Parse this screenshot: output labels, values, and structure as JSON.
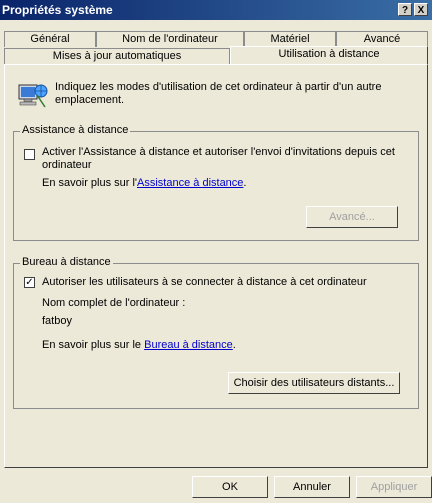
{
  "window": {
    "title": "Propriétés système",
    "help_label": "?",
    "close_label": "X"
  },
  "tabs_back": [
    {
      "label": "Général"
    },
    {
      "label": "Nom de l'ordinateur"
    },
    {
      "label": "Matériel"
    },
    {
      "label": "Avancé"
    }
  ],
  "tabs_front": [
    {
      "label": "Mises à jour automatiques"
    },
    {
      "label": "Utilisation à distance"
    }
  ],
  "intro": {
    "icon": "computer-network-icon",
    "text": "Indiquez les modes d'utilisation de cet ordinateur à partir d'un autre emplacement."
  },
  "assistance": {
    "legend": "Assistance à distance",
    "checkbox_label": "Activer l'Assistance à distance et autoriser l'envoi d'invitations depuis cet ordinateur",
    "checked": false,
    "learn_prefix": "En savoir plus sur l'",
    "learn_link": "Assistance à distance",
    "learn_suffix": ".",
    "advanced_label": "Avancé..."
  },
  "bureau": {
    "legend": "Bureau à distance",
    "checkbox_label": "Autoriser les utilisateurs à se connecter à distance à cet ordinateur",
    "checked": true,
    "computer_name_label": "Nom complet de l'ordinateur :",
    "computer_name": "fatboy",
    "learn_prefix": "En savoir plus sur le ",
    "learn_link": "Bureau à distance",
    "learn_suffix": ".",
    "choose_users_label": "Choisir des utilisateurs distants..."
  },
  "footer": {
    "ok_label": "OK",
    "cancel_label": "Annuler",
    "apply_label": "Appliquer"
  }
}
